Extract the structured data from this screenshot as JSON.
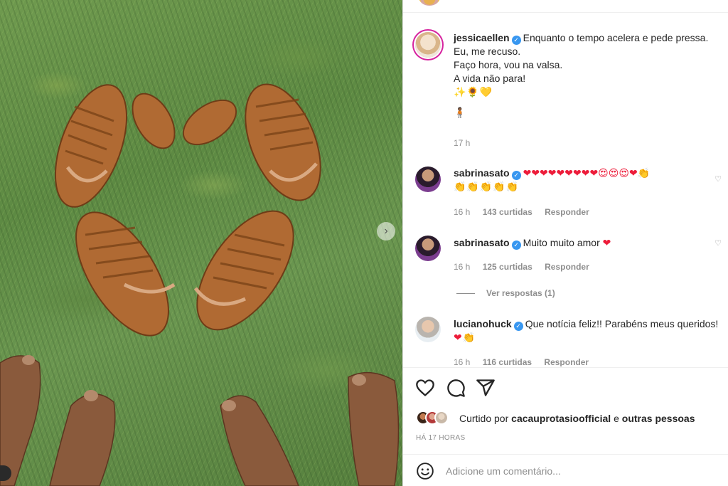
{
  "post": {
    "author": "jessicaellen",
    "caption_lines": [
      "Enquanto o tempo acelera e pede pressa.",
      "Eu, me recuso.",
      "Faço hora, vou na valsa.",
      "A vida não para!"
    ],
    "caption_emoji_1": "✨🌻💛",
    "caption_emoji_2": "🧍🏾",
    "time": "17 h"
  },
  "comments": [
    {
      "user": "sabrinasato",
      "text_line1": "❤❤❤❤❤❤❤❤❤😍😍😍❤👏",
      "text_line2": "👏👏👏👏👏",
      "time": "16 h",
      "likes": "143 curtidas",
      "reply": "Responder"
    },
    {
      "user": "sabrinasato",
      "text": "Muito muito amor",
      "emoji": "❤",
      "time": "16 h",
      "likes": "125 curtidas",
      "reply": "Responder",
      "view_replies": "Ver respostas (1)"
    },
    {
      "user": "lucianohuck",
      "text": "Que notícia feliz!! Parabéns meus queridos!",
      "text_line2": "❤👏",
      "time": "16 h",
      "likes": "116 curtidas",
      "reply": "Responder"
    }
  ],
  "actions": {
    "liked_prefix": "Curtido por",
    "liked_user": "cacauprotasioofficial",
    "liked_and": "e",
    "liked_others": "outras pessoas",
    "time_ago": "HÁ 17 HORAS"
  },
  "comment_box": {
    "placeholder": "Adicione um comentário..."
  },
  "colors": {
    "verified": "#3897f0",
    "heart": "#ed1c3a",
    "muted": "#8e8e8e",
    "text": "#262626"
  },
  "icons": [
    "heart-icon",
    "comment-icon",
    "share-icon",
    "emoji-icon",
    "verified-icon",
    "chevron-right-icon"
  ]
}
